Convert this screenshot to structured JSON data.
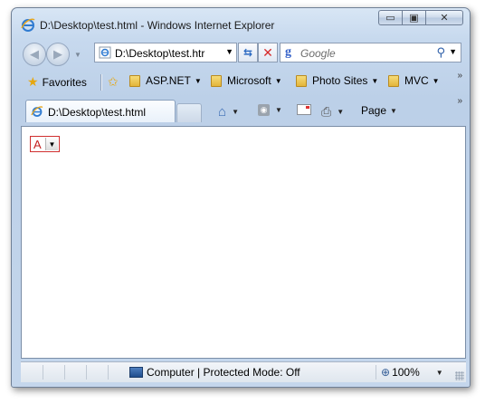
{
  "window": {
    "title": "D:\\Desktop\\test.html - Windows Internet Explorer"
  },
  "caption_buttons": {
    "minimize": "▭",
    "maximize": "▣",
    "close": "✕"
  },
  "address_bar": {
    "url": "D:\\Desktop\\test.htr",
    "icon": "ie-page-icon"
  },
  "search": {
    "placeholder": "Google",
    "provider_glyph": "g"
  },
  "favorites_bar": {
    "favorites_label": "Favorites",
    "items": [
      {
        "label": "ASP.NET"
      },
      {
        "label": "Microsoft"
      },
      {
        "label": "Photo Sites"
      },
      {
        "label": "MVC"
      }
    ],
    "overflow": "»"
  },
  "tabs": {
    "active_label": "D:\\Desktop\\test.html"
  },
  "command_bar": {
    "page_label": "Page",
    "overflow": "»"
  },
  "content": {
    "select_value": "A"
  },
  "status_bar": {
    "zone_text": "Computer | Protected Mode: Off",
    "zoom": "100%"
  },
  "colors": {
    "select_border": "#d02f2f",
    "select_text": "#c41f1f",
    "frame": "#c4d6ec"
  }
}
